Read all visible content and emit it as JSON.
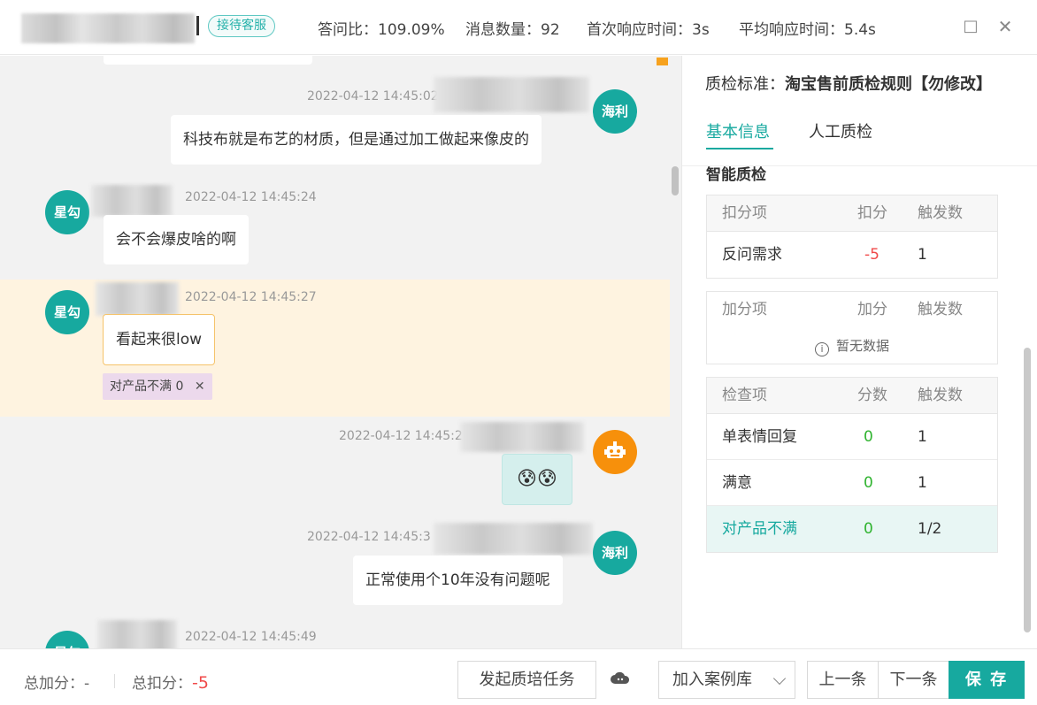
{
  "header": {
    "service_tag": "接待客服",
    "stats": [
      {
        "label": "答问比：",
        "value": "109.09%"
      },
      {
        "label": "消息数量：",
        "value": "92"
      },
      {
        "label": "首次响应时间：",
        "value": "3s"
      },
      {
        "label": "平均响应时间：",
        "value": "5.4s"
      }
    ],
    "window_controls": {
      "maximize": "□",
      "close": "✕"
    }
  },
  "chat": {
    "messages": [
      {
        "sender": "海利",
        "time": "2022-04-12 14:45:02",
        "text": "科技布就是布艺的材质，但是通过加工做起来像皮的",
        "side": "right"
      },
      {
        "sender": "星勾",
        "time": "2022-04-12 14:45:24",
        "text": "会不会爆皮啥的啊",
        "side": "left"
      },
      {
        "sender": "星勾",
        "time": "2022-04-12 14:45:27",
        "text": "看起来很low",
        "side": "left",
        "tag": "对产品不满 0",
        "tag_close": "✕"
      },
      {
        "sender": "bot",
        "time": "2022-04-12 14:45:2",
        "text": "😰😰",
        "side": "right"
      },
      {
        "sender": "海利",
        "time": "2022-04-12 14:45:3",
        "text": "正常使用个10年没有问题呢",
        "side": "right"
      },
      {
        "sender": "星勾",
        "time": "2022-04-12 14:45:49",
        "text": "",
        "side": "left"
      }
    ]
  },
  "panel": {
    "standard_label": "质检标准：",
    "standard_value": "淘宝售前质检规则【勿修改】",
    "tabs": [
      "基本信息",
      "人工质检"
    ],
    "section_title": "智能质检",
    "deduct_table": {
      "headers": [
        "扣分项",
        "扣分",
        "触发数"
      ],
      "rows": [
        {
          "item": "反问需求",
          "score": "-5",
          "count": "1"
        }
      ]
    },
    "bonus_table": {
      "headers": [
        "加分项",
        "加分",
        "触发数"
      ],
      "empty_text": "暂无数据"
    },
    "check_table": {
      "headers": [
        "检查项",
        "分数",
        "触发数"
      ],
      "rows": [
        {
          "item": "单表情回复",
          "score": "0",
          "count": "1"
        },
        {
          "item": "满意",
          "score": "0",
          "count": "1"
        },
        {
          "item": "对产品不满",
          "score": "0",
          "count": "1/2"
        }
      ]
    }
  },
  "footer": {
    "total_add_label": "总加分：",
    "total_add_value": "-",
    "total_deduct_label": "总扣分：",
    "total_deduct_value": "-5",
    "training_button": "发起质培任务",
    "case_library": "加入案例库",
    "prev_button": "上一条",
    "next_button": "下一条",
    "save_button": "保 存"
  },
  "colors": {
    "accent": "#17a99f",
    "deduct": "#f04a4a",
    "bonus": "#2fb32f",
    "highlight": "#fef3e0"
  }
}
